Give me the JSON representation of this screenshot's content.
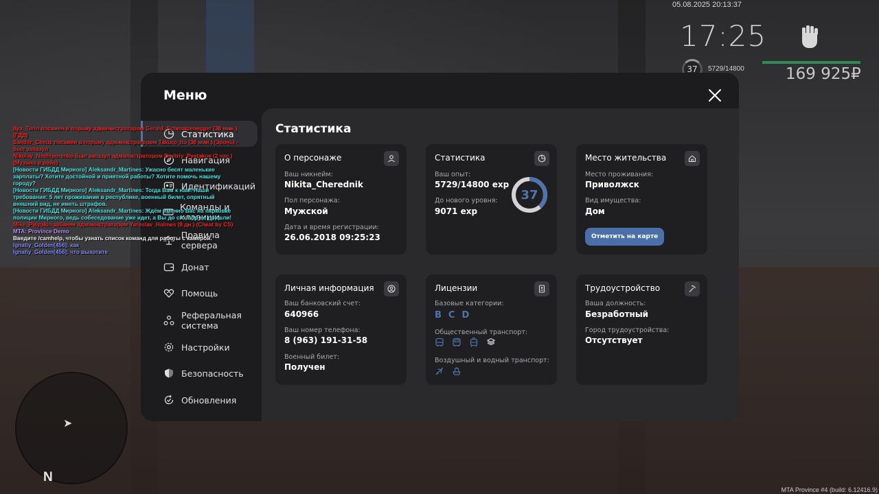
{
  "hud": {
    "date": "05.08.2025 20:13:37",
    "time": "17:25",
    "level": "37",
    "exp": "5729/14800",
    "money": "169 925₽"
  },
  "menu": {
    "title": "Меню",
    "nav": [
      {
        "label": "Статистика",
        "icon": "stats-icon",
        "active": true
      },
      {
        "label": "Навигация",
        "icon": "compass-icon"
      },
      {
        "label": "Идентификаций",
        "icon": "id-icon"
      },
      {
        "label": "Команды и клавиши",
        "icon": "keyboard-icon"
      },
      {
        "label": "Правила сервера",
        "icon": "scales-icon"
      },
      {
        "label": "Донат",
        "icon": "wallet-icon"
      },
      {
        "label": "Помощь",
        "icon": "handshake-icon"
      },
      {
        "label": "Реферальная система",
        "icon": "referral-icon"
      },
      {
        "label": "Настройки",
        "icon": "gear-icon"
      },
      {
        "label": "Безопасность",
        "icon": "shield-icon"
      },
      {
        "label": "Обновления",
        "icon": "update-icon"
      }
    ]
  },
  "content": {
    "title": "Статистика",
    "character": {
      "title": "О персонаже",
      "nickname_label": "Ваш никнейм:",
      "nickname": "Nikita_Cherednik",
      "gender_label": "Пол персонажа:",
      "gender": "Мужской",
      "reg_label": "Дата и время регистрации:",
      "reg": "26.06.2018 09:25:23"
    },
    "stats": {
      "title": "Статистика",
      "exp_label": "Ваш опыт:",
      "exp": "5729/14800 exp",
      "next_label": "До нового уровня:",
      "next": "9071 exp",
      "level": "37",
      "progress": 0.387
    },
    "residence": {
      "title": "Место жительства",
      "place_label": "Место проживания:",
      "place": "Приволжск",
      "property_label": "Вид имущества:",
      "property": "Дом",
      "map_button": "Отметить на карте"
    },
    "personal": {
      "title": "Личная информация",
      "bank_label": "Ваш банковский счет:",
      "bank": "640966",
      "phone_label": "Ваш номер телефона:",
      "phone": "8 (963) 191-31-58",
      "military_label": "Военный билет:",
      "military": "Получен"
    },
    "licenses": {
      "title": "Лицензии",
      "base_label": "Базовые категории:",
      "base": [
        "B",
        "C",
        "D"
      ],
      "public_label": "Общественный транспорт:",
      "air_label": "Воздушный и водный транспорт:"
    },
    "job": {
      "title": "Трудоустройство",
      "position_label": "Ваша должность:",
      "position": "Безработный",
      "city_label": "Город трудоустройства:",
      "city": "Отсутствует"
    }
  },
  "chat": [
    {
      "text": "Ilya_Turin посажен в порьму администратором Gerald_Schmatzenegger (30 мин.) (ГДД)",
      "color": "red"
    },
    {
      "text": "Sander_Cheuz посажен в порьму администратором Takuro_Ito (30 мин.) (Зрочь) - был запазул",
      "color": "red"
    },
    {
      "text": "Nikolay_Nechiporenko был запазул администратором Dmitriy_Pyatakov (2 час.) (Музыка в войс)",
      "color": "red"
    },
    {
      "text": "[Новости ГИБДД Мирного] Aleksandr_Martines: Ужасно бесят маленькие зарплаты? Хотите достойной и приятной работы? Хотите помочь нашему городу?",
      "color": "cyan"
    },
    {
      "text": "[Новости ГИБДД Мирного] Aleksandr_Martines: Тогда Вам к нам! Наши требования: 5 лет проживания в республике, военный билет, опрятный внешний вид, не иметь штрафов.",
      "color": "cyan"
    },
    {
      "text": "[Новости ГИБДД Мирного] Aleksandr_Martines: Ждём именно Вас на парковке полиции Мирного, ведь собеседование уже идет, а Вы до сих пор не пришли!",
      "color": "cyan"
    },
    {
      "text": "Mike_Pisyukin забанен администратором Yaroslav_Holmes (8 дн.) (Cheat by CS)",
      "color": "red"
    },
    {
      "text": "MTA: Province Demo",
      "color": "purple"
    },
    {
      "text": "Введите /camhelp, чтобы узнать список команд для работы с камерой.",
      "color": "white"
    },
    {
      "text": "Ignatiy_Golden[456]: как",
      "color": "blue"
    },
    {
      "text": "Ignatiy_Golden[456]: что выхотите",
      "color": "blue"
    }
  ],
  "minimap": {
    "north": "N"
  },
  "build": "MTA Province #4 (build: 6.12416.9)"
}
